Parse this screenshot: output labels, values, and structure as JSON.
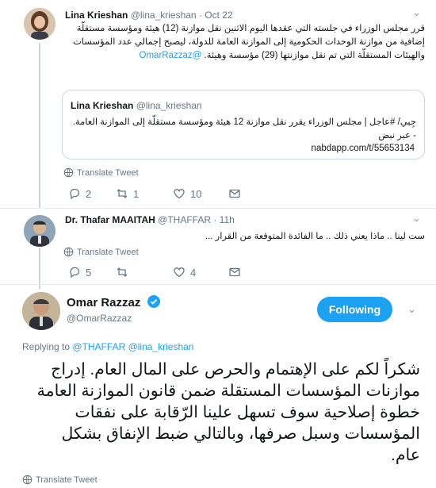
{
  "tweet1": {
    "name": "Lina Krieshan",
    "handle": "@lina_krieshan",
    "date": "· Oct 22",
    "text": "قرر مجلس الوزراء في جلسته التي عقدها اليوم الاثنين نقل موازنة (12) هيئة ومؤسسة مستقلّة إضافية من موازنة الوحدات الحكومية إلى الموازنة العامة للدولة، ليصبح إجمالي عدد المؤسسات والهيئات المستقلّة التي تم نقل موازنتها (29) مؤسسة وهيئة.",
    "mention": "@OmarRazzaz",
    "quote": {
      "name": "Lina Krieshan",
      "handle": "@lina_krieshan",
      "text": "جِبي/ #عاجل | مجلس الوزراء يقرر نقل موازنة 12 هيئة ومؤسسة مستقلّة إلى الموازنة العامة. - عبر نبض",
      "link": "nabdapp.com/t/55653134"
    },
    "translate": "Translate Tweet",
    "replies": "2",
    "retweets": "1",
    "likes": "10"
  },
  "tweet2": {
    "name": "Dr. Thafar MAAITAH",
    "handle": "@THAFFAR",
    "date": "· 11h",
    "text": "ست لينا .. ماذا يعني ذلك .. ما الفائدة المتوقعة من القرار ...",
    "translate": "Translate Tweet",
    "replies": "5",
    "retweets": "",
    "likes": "4"
  },
  "tweet3": {
    "name": "Omar Razzaz",
    "handle": "@OmarRazzaz",
    "follow_label": "Following",
    "replying_prefix": "Replying to",
    "replying_to": "@THAFFAR @lina_krieshan",
    "text": "شكراً لكم على الإهتمام والحرص على المال العام. إدراج موازنات المؤسسات المستقلة ضمن قانون الموازنة العامة خطوة إصلاحية سوف تسهل علينا الرّقابة على نفقات المؤسسات وسبل صرفها، وبالتالي ضبط الإنفاق بشكل عام.",
    "translate": "Translate Tweet"
  },
  "colors": {
    "accent": "#1da1f2",
    "muted": "#657786",
    "verified": "#1da1f2"
  },
  "icons": [
    "reply-icon",
    "retweet-icon",
    "like-icon",
    "dm-icon",
    "translate-globe-icon",
    "chevron-down-icon",
    "verified-badge-icon"
  ]
}
